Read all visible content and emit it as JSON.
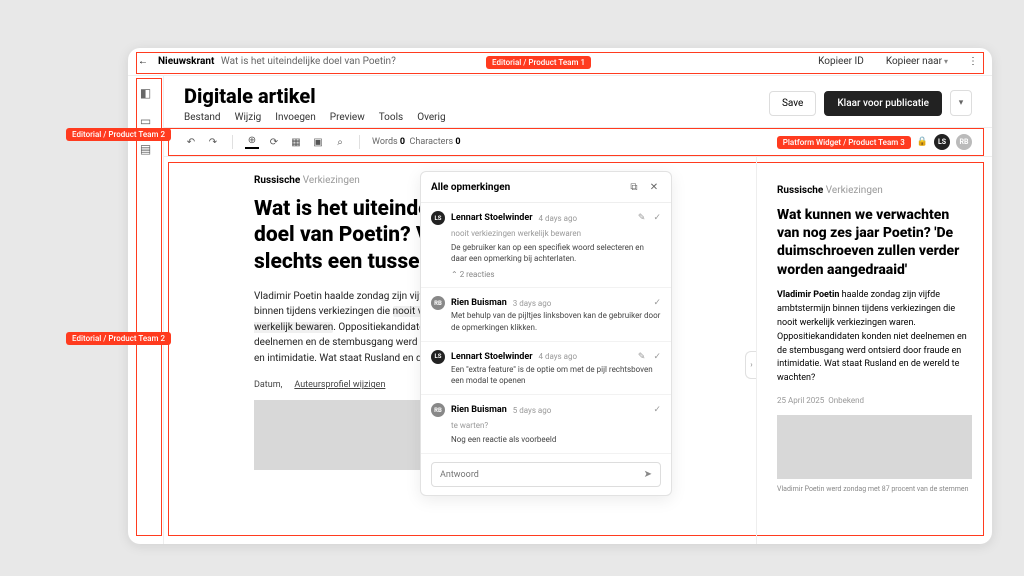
{
  "annotations": {
    "top": "Editorial / Product Team 1",
    "left1": "Editorial / Product Team 2",
    "left2": "Editorial / Product Team 2",
    "toolbar_right": "Platform Widget / Product Team 3"
  },
  "topbar": {
    "brand": "Nieuwskrant",
    "crumb": "Wat is het uiteindelijke doel van Poetin?",
    "copy_id": "Kopieer ID",
    "copy_to": "Kopieer naar"
  },
  "header": {
    "title": "Digitale artikel",
    "menu": [
      "Bestand",
      "Wijzig",
      "Invoegen",
      "Preview",
      "Tools",
      "Overig"
    ],
    "save": "Save",
    "publish": "Klaar voor publicatie"
  },
  "toolbar": {
    "words_label": "Words",
    "words_value": "0",
    "chars_label": "Characters",
    "chars_value": "0",
    "avatars": [
      "LS",
      "RB"
    ]
  },
  "article": {
    "kicker_bold": "Russische",
    "kicker_rest": "Verkiezingen",
    "headline": "Wat is het uiteindelijke doel van Poetin? Vrede is slechts een tussenstap",
    "body": "Vladimir Poetin haalde zondag zijn vijfde ambtstermijn binnen tijdens verkiezingen die nooit verkiezingen werkelijk bewaren. Oppositiekandidaten konden niet deelnemen en de stembusgang werd ontsierd door fraude en intimidatie. Wat staat Rusland en de wereld te warten?",
    "highlight": "nooit verkiezingen werkelijk bewaren",
    "date_label": "Datum,",
    "author_link": "Auteursprofiel wijzigen"
  },
  "comments": {
    "title": "Alle opmerkingen",
    "reply_placeholder": "Antwoord",
    "replies_toggle": "2 reacties",
    "items": [
      {
        "initials": "LS",
        "av": "dark",
        "name": "Lennart Stoelwinder",
        "time": "4 days ago",
        "quote": "nooit verkiezingen werkelijk bewaren",
        "text": "De gebruiker kan op een specifiek woord selecteren en daar een opmerking bij achterlaten.",
        "show_replies_toggle": true,
        "editable": true
      },
      {
        "initials": "RB",
        "av": "grey",
        "name": "Rien Buisman",
        "time": "3 days ago",
        "text": "Met behulp van de pijltjes linksboven kan de gebruiker door de opmerkingen klikken.",
        "editable": false
      },
      {
        "initials": "LS",
        "av": "dark",
        "name": "Lennart Stoelwinder",
        "time": "4 days ago",
        "text": "Een \"extra feature\" is de optie om met de pijl rechtsboven een modal te openen",
        "editable": true
      },
      {
        "initials": "RB",
        "av": "grey",
        "name": "Rien Buisman",
        "time": "5 days ago",
        "quote": "te warten?",
        "text": "Nog een reactie als voorbeeld",
        "editable": false
      }
    ]
  },
  "preview": {
    "kicker_bold": "Russische",
    "kicker_rest": "Verkiezingen",
    "headline": "Wat kunnen we verwachten van nog zes jaar Poetin? 'De duimschroeven zullen verder worden aangedraaid'",
    "body": "Vladimir Poetin haalde zondag zijn vijfde ambtstermijn binnen tijdens verkiezingen die nooit werkelijk verkiezingen waren. Oppositiekandidaten konden niet deelnemen en de stembusgang werd ontsierd door fraude en intimidatie. Wat staat Rusland en de wereld te wachten?",
    "date": "25 April 2025",
    "author": "Onbekend",
    "caption": "Vladimir Poetin werd zondag met 87 procent van de stemmen"
  }
}
